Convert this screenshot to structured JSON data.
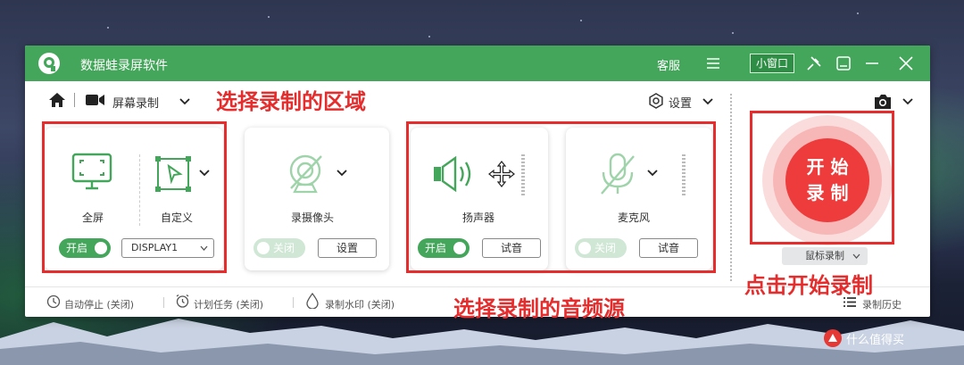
{
  "titlebar": {
    "app_title": "数据蛙录屏软件",
    "customer_service": "客服",
    "mini_window": "小窗口"
  },
  "nav": {
    "mode": "屏幕录制",
    "settings": "设置"
  },
  "sources": {
    "fullscreen": "全屏",
    "custom": "自定义",
    "region_toggle": "开启",
    "display": "DISPLAY1",
    "camera": "录摄像头",
    "camera_toggle": "关闭",
    "camera_settings": "设置",
    "speaker": "扬声器",
    "speaker_toggle": "开启",
    "speaker_test": "试音",
    "mic": "麦克风",
    "mic_toggle": "关闭",
    "mic_test": "试音"
  },
  "record": {
    "start_line1": "开 始",
    "start_line2": "录 制",
    "mouse_record": "鼠标录制"
  },
  "footer": {
    "auto_stop": "自动停止 (关闭)",
    "schedule": "计划任务 (关闭)",
    "watermark": "录制水印 (关闭)",
    "history": "录制历史"
  },
  "annotations": {
    "region": "选择录制的区域",
    "audio": "选择录制的音频源",
    "start": "点击开始录制"
  },
  "image_watermark": "什么值得买",
  "colors": {
    "brand_green": "#43a65a",
    "annotation_red": "#e52d2d",
    "record_red": "#ee3b3b"
  }
}
